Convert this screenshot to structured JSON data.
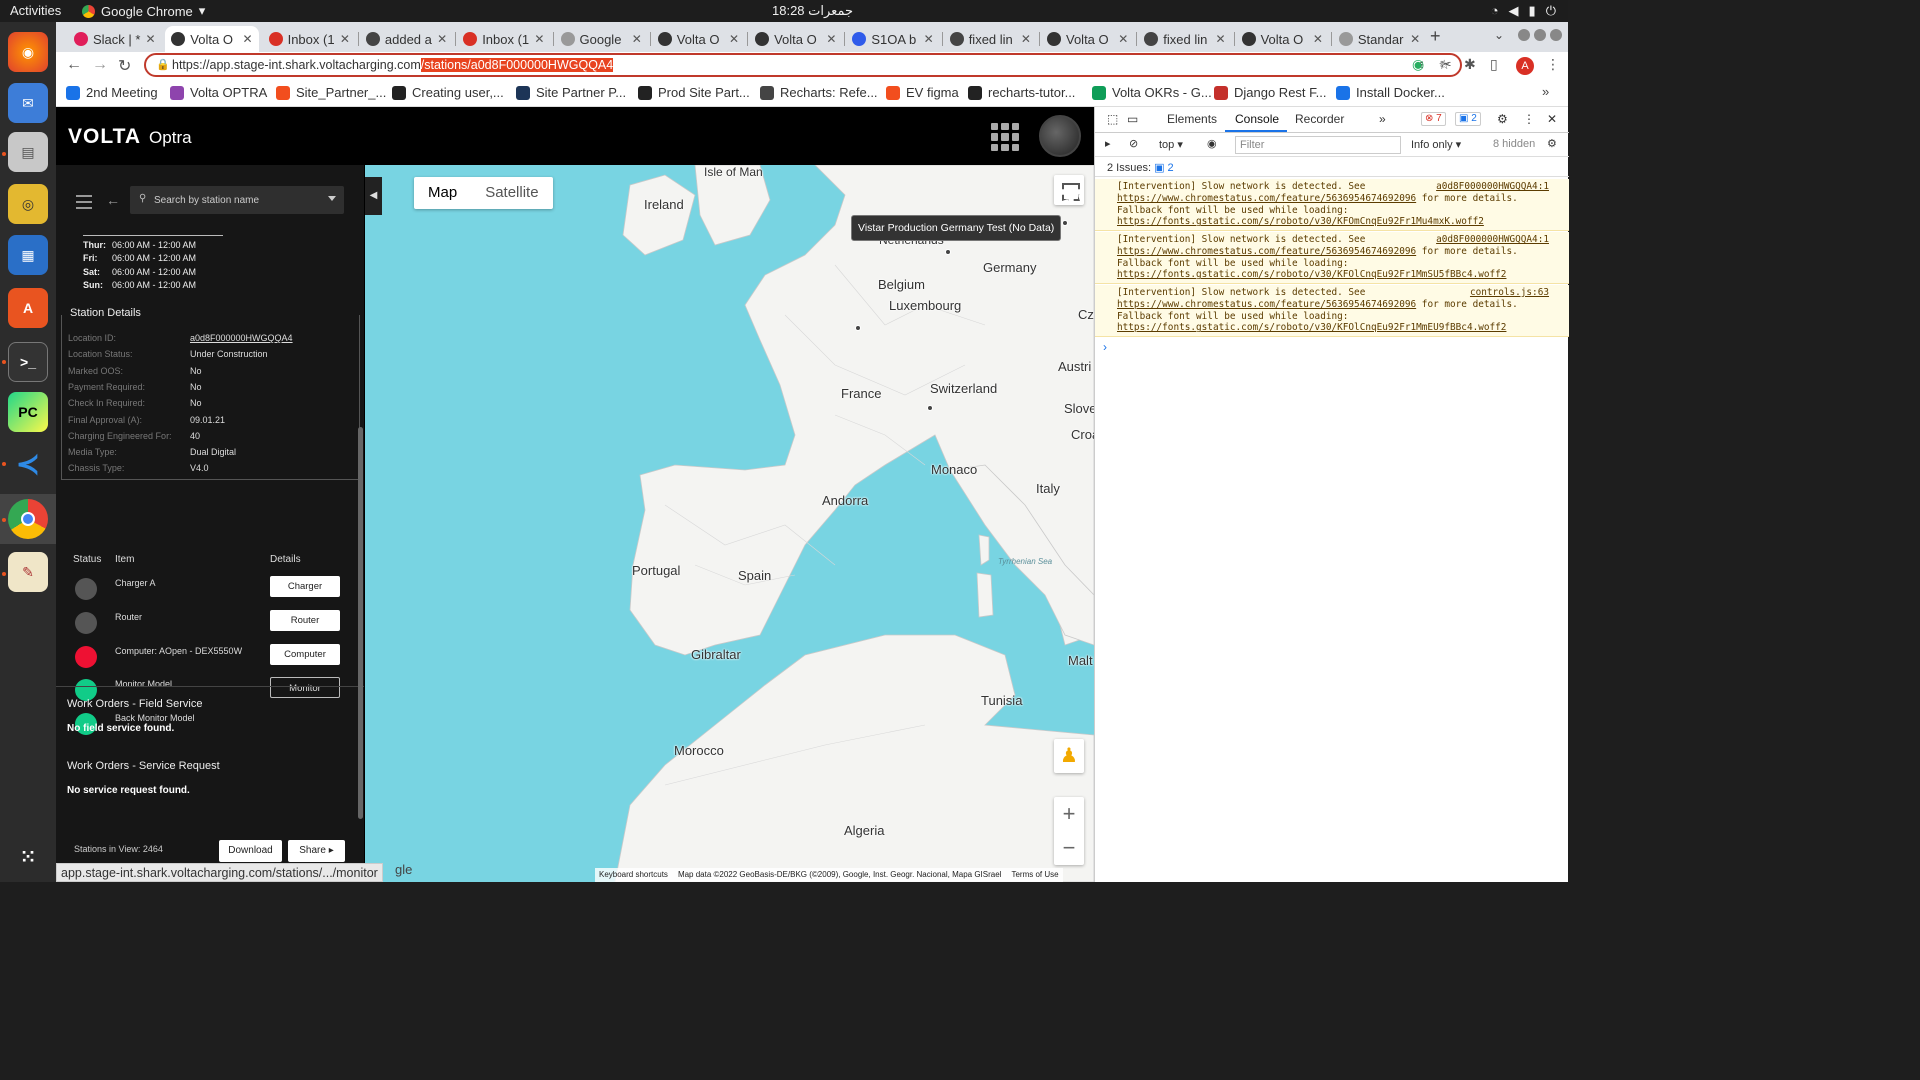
{
  "os": {
    "activities": "Activities",
    "app_name": "Google Chrome",
    "clock": "جمعرات 18:28"
  },
  "browser": {
    "tabs": [
      {
        "label": "Slack | *",
        "color": "#e01e5a"
      },
      {
        "label": "Volta O",
        "color": "#333333"
      },
      {
        "label": "Inbox (1",
        "color": "#d93025"
      },
      {
        "label": "added a",
        "color": "#444444"
      },
      {
        "label": "Inbox (1",
        "color": "#d93025"
      },
      {
        "label": "Google",
        "color": "#999999"
      },
      {
        "label": "Volta O",
        "color": "#333333"
      },
      {
        "label": "Volta O",
        "color": "#333333"
      },
      {
        "label": "S1OA b",
        "color": "#2f5bea"
      },
      {
        "label": "fixed lin",
        "color": "#444444"
      },
      {
        "label": "Volta O",
        "color": "#333333"
      },
      {
        "label": "fixed lin",
        "color": "#444444"
      },
      {
        "label": "Volta O",
        "color": "#333333"
      },
      {
        "label": "Standar",
        "color": "#999999"
      }
    ],
    "url_base": "https://app.stage-int.shark.voltacharging.com",
    "url_selected": "/stations/a0d8F000000HWGQQA4",
    "bookmarks": [
      {
        "label": "2nd Meeting",
        "color": "#1a73e8"
      },
      {
        "label": "Volta OPTRA",
        "color": "#8e44ad"
      },
      {
        "label": "Site_Partner_...",
        "color": "#f24e1e"
      },
      {
        "label": "Creating user,...",
        "color": "#222222"
      },
      {
        "label": "Site Partner P...",
        "color": "#1d3557"
      },
      {
        "label": "Prod Site Part...",
        "color": "#222222"
      },
      {
        "label": "Recharts: Refe...",
        "color": "#444444"
      },
      {
        "label": "EV figma",
        "color": "#f24e1e"
      },
      {
        "label": "recharts-tutor...",
        "color": "#222222"
      },
      {
        "label": "Volta OKRs - G...",
        "color": "#0f9d58"
      },
      {
        "label": "Django Rest F...",
        "color": "#c4302b"
      },
      {
        "label": "Install Docker...",
        "color": "#1a73e8"
      }
    ],
    "status_url": "app.stage-int.shark.voltacharging.com/stations/.../monitor"
  },
  "app": {
    "logo": "VOLTA",
    "product": "Optra",
    "search_placeholder": "Search by station name",
    "hours": [
      {
        "day": "Thur:",
        "time": "06:00 AM - 12:00 AM"
      },
      {
        "day": "Fri:",
        "time": "06:00 AM - 12:00 AM"
      },
      {
        "day": "Sat:",
        "time": "06:00 AM - 12:00 AM"
      },
      {
        "day": "Sun:",
        "time": "06:00 AM - 12:00 AM"
      }
    ],
    "details_title": "Station Details",
    "details": [
      {
        "k": "Location ID:",
        "v": "a0d8F000000HWGQQA4"
      },
      {
        "k": "Location Status:",
        "v": "Under Construction"
      },
      {
        "k": "Marked OOS:",
        "v": "No"
      },
      {
        "k": "Payment Required:",
        "v": "No"
      },
      {
        "k": "Check In Required:",
        "v": "No"
      },
      {
        "k": "Final Approval (A):",
        "v": "09.01.21"
      },
      {
        "k": "Charging Engineered For:",
        "v": "40"
      },
      {
        "k": "Media Type:",
        "v": "Dual Digital"
      },
      {
        "k": "Chassis Type:",
        "v": "V4.0"
      }
    ],
    "components_headers": {
      "status": "Status",
      "item": "Item",
      "details": "Details"
    },
    "components": [
      {
        "name": "Charger A",
        "status_color": "#555555",
        "button": "Charger"
      },
      {
        "name": "Router",
        "status_color": "#555555",
        "button": "Router"
      },
      {
        "name": "Computer: AOpen - DEX5550W",
        "status_color": "#ee1133",
        "button": "Computer"
      },
      {
        "name": "Monitor Model",
        "status_color": "#11cc88",
        "button": "Monitor"
      },
      {
        "name": "Back Monitor Model",
        "status_color": "#11cc88",
        "button": ""
      }
    ],
    "wo_field_title": "Work Orders - Field Service",
    "wo_field_text": "No field service found.",
    "wo_request_title": "Work Orders - Service Request",
    "wo_request_text": "No service request found.",
    "stations_in_view": "Stations in View: 2464",
    "download": "Download",
    "share": "Share"
  },
  "map": {
    "type_map": "Map",
    "type_satellite": "Satellite",
    "tooltip": "Vistar Production Germany Test (No Data)",
    "labels": [
      "Isle of Man",
      "Ireland",
      "Netherlands",
      "Germany",
      "Belgium",
      "Luxembourg",
      "Cze",
      "Austri",
      "France",
      "Switzerland",
      "Slove",
      "Croa",
      "Monaco",
      "Italy",
      "Andorra",
      "Portugal",
      "Spain",
      "Tyrrhenian Sea",
      "Gibraltar",
      "Malt",
      "Tunisia",
      "Morocco",
      "Algeria"
    ],
    "attribution": [
      "Keyboard shortcuts",
      "Map data ©2022 GeoBasis-DE/BKG (©2009), Google, Inst. Geogr. Nacional, Mapa GISrael",
      "Terms of Use"
    ],
    "google": "gle"
  },
  "devtools": {
    "tabs": [
      "Elements",
      "Console",
      "Recorder"
    ],
    "errors": "7",
    "messages": "2",
    "context": "top",
    "filter_placeholder": "Filter",
    "level": "Info only",
    "hidden": "8 hidden",
    "issues_label": "2 Issues:",
    "issues_count": "2",
    "messages_list": [
      {
        "prefix": "[Intervention] Slow network is detected. See ",
        "link1": "https://www.chromestatus.com/feature/5636954674692096",
        "mid": " for more details. Fallback font will be used while loading: ",
        "link2": "https://fonts.gstatic.com/s/roboto/v30/KFOmCnqEu92Fr1Mu4mxK.woff2",
        "src": "a0d8F000000HWGQQA4:1"
      },
      {
        "prefix": "[Intervention] Slow network is detected. See ",
        "link1": "https://www.chromestatus.com/feature/5636954674692096",
        "mid": " for more details. Fallback font will be used while loading: ",
        "link2": "https://fonts.gstatic.com/s/roboto/v30/KFOlCnqEu92Fr1MmSU5fBBc4.woff2",
        "src": "a0d8F000000HWGQQA4:1"
      },
      {
        "prefix": "[Intervention] Slow network is detected. See ",
        "link1": "https://www.chromestatus.com/feature/5636954674692096",
        "mid": " for more details. Fallback font will be used while loading: ",
        "link2": "https://fonts.gstatic.com/s/roboto/v30/KFOlCnqEu92Fr1MmEU9fBBc4.woff2",
        "src": "controls.js:63"
      }
    ]
  }
}
